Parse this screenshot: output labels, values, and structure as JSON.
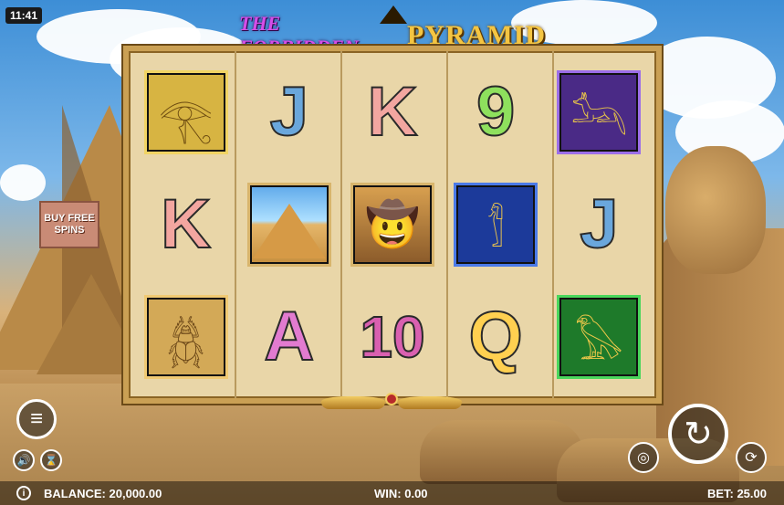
{
  "status": {
    "clock": "11:41"
  },
  "title": {
    "prefix": "THE FORBIDDEN",
    "main": "PYRAMID"
  },
  "side": {
    "buy_label": "BUY FREE SPINS"
  },
  "reels": [
    [
      "eye",
      "K",
      "scarab"
    ],
    [
      "J",
      "pyramid",
      "A"
    ],
    [
      "K",
      "explorer",
      "10"
    ],
    [
      "9",
      "pharaoh",
      "Q"
    ],
    [
      "anubis",
      "J",
      "bird"
    ]
  ],
  "footer": {
    "balance_label": "BALANCE:",
    "balance_value": "20,000.00",
    "win_label": "WIN:",
    "win_value": "0.00",
    "bet_label": "BET:",
    "bet_value": "25.00"
  },
  "icons": {
    "menu": "menu-icon",
    "sound": "speaker-icon",
    "fastplay": "hourglass-off-icon",
    "spin": "spin-icon",
    "coins": "coin-stack-icon",
    "autoplay": "autoplay-icon",
    "info": "info-icon"
  }
}
